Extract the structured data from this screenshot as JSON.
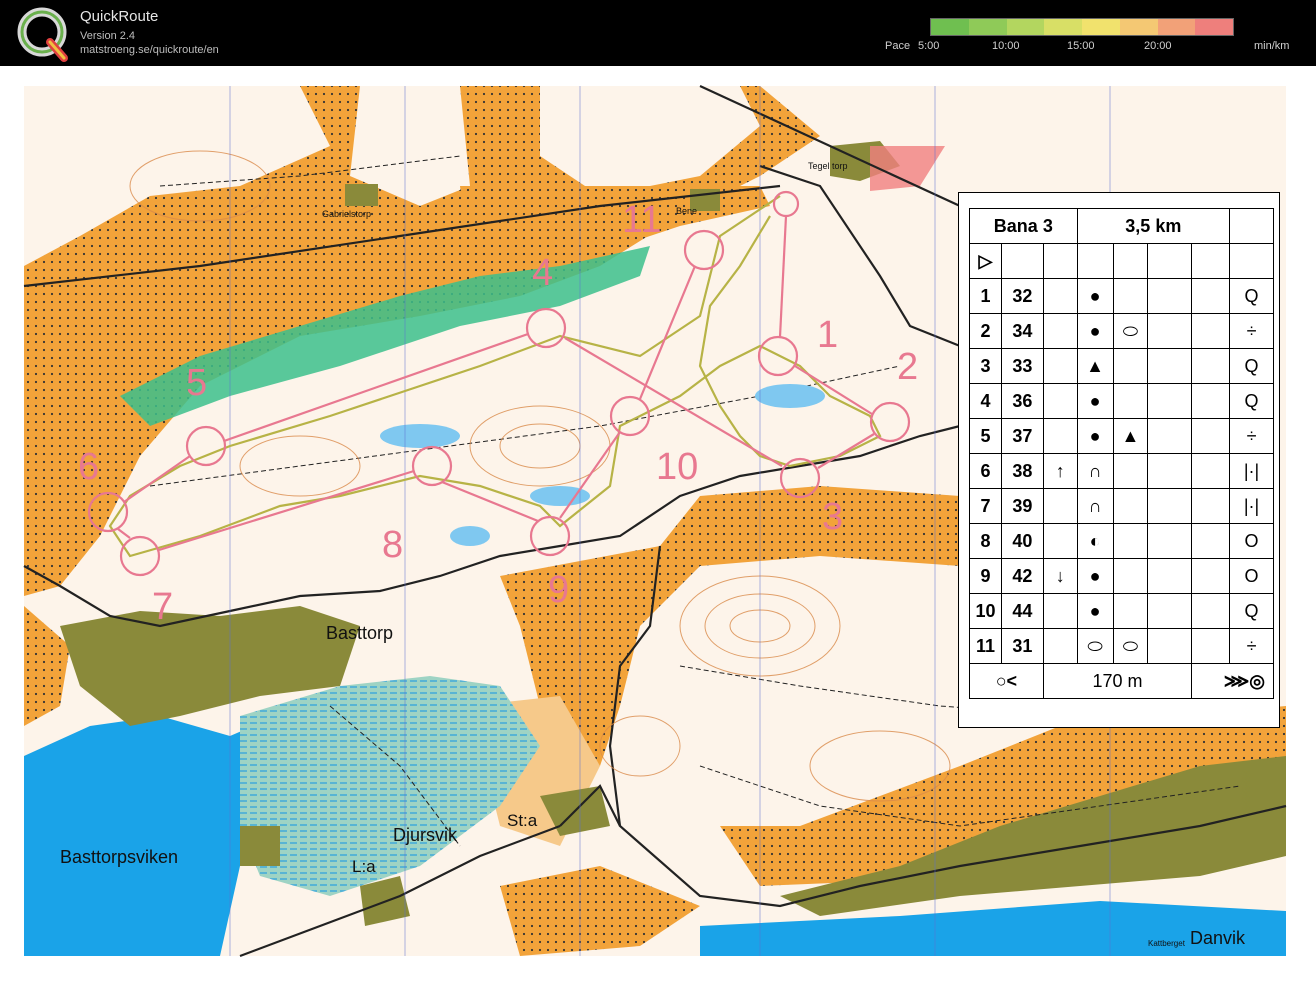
{
  "app": {
    "title": "QuickRoute",
    "version": "Version 2.4",
    "url": "matstroeng.se/quickroute/en"
  },
  "pace_scale": {
    "label": "Pace",
    "ticks": [
      "5:00",
      "10:00",
      "15:00",
      "20:00"
    ],
    "unit": "min/km",
    "colors": [
      "#6fbf50",
      "#8fca58",
      "#b3d65f",
      "#d8df66",
      "#f1e26d",
      "#f4c873",
      "#f2a178",
      "#ee7f7c"
    ]
  },
  "map": {
    "place_names": {
      "basttorp": "Basttorp",
      "basttorpsviken": "Basttorpsviken",
      "djursvik": "Djursvik",
      "sta": "St:a",
      "la": "L:a",
      "danvik": "Danvik",
      "tegeltorp": "Tegel torp",
      "gabrielstorp": "Gabrielstorp",
      "bene": "Bene",
      "kattberget": "Kattberget"
    },
    "control_numbers": [
      "1",
      "2",
      "3",
      "4",
      "5",
      "6",
      "7",
      "8",
      "9",
      "10",
      "11"
    ],
    "colors": {
      "open_land": "#f2a33a",
      "forest": "#ffffff",
      "water": "#1aa3e8",
      "marsh": "#3cbfb2",
      "settlement": "#8a8a3a",
      "course": "#e87890",
      "route": "#c9c66a",
      "contour": "#d98a4a"
    }
  },
  "legend": {
    "course_name": "Bana 3",
    "length": "3,5 km",
    "start_symbol": "start-triangle-icon",
    "controls": [
      {
        "seq": "1",
        "code": "32",
        "direction": "",
        "feature": "●",
        "feature2": "",
        "location": "Q"
      },
      {
        "seq": "2",
        "code": "34",
        "direction": "",
        "feature": "●",
        "feature2": "⬭",
        "location": "÷"
      },
      {
        "seq": "3",
        "code": "33",
        "direction": "",
        "feature": "▲",
        "feature2": "",
        "location": "Q"
      },
      {
        "seq": "4",
        "code": "36",
        "direction": "",
        "feature": "●",
        "feature2": "",
        "location": "Q"
      },
      {
        "seq": "5",
        "code": "37",
        "direction": "",
        "feature": "●",
        "feature2": "▲",
        "location": "÷"
      },
      {
        "seq": "6",
        "code": "38",
        "direction": "↑",
        "feature": "∩",
        "feature2": "",
        "location": "|·|"
      },
      {
        "seq": "7",
        "code": "39",
        "direction": "",
        "feature": "∩",
        "feature2": "",
        "location": "|·|"
      },
      {
        "seq": "8",
        "code": "40",
        "direction": "",
        "feature": "◐",
        "feature2": "",
        "location": "O"
      },
      {
        "seq": "9",
        "code": "42",
        "direction": "↓",
        "feature": "●",
        "feature2": "",
        "location": "O"
      },
      {
        "seq": "10",
        "code": "44",
        "direction": "",
        "feature": "●",
        "feature2": "",
        "location": "Q"
      },
      {
        "seq": "11",
        "code": "31",
        "direction": "",
        "feature": "⬭",
        "feature2": "⬭",
        "location": "÷"
      }
    ],
    "finish_distance": "170 m"
  }
}
